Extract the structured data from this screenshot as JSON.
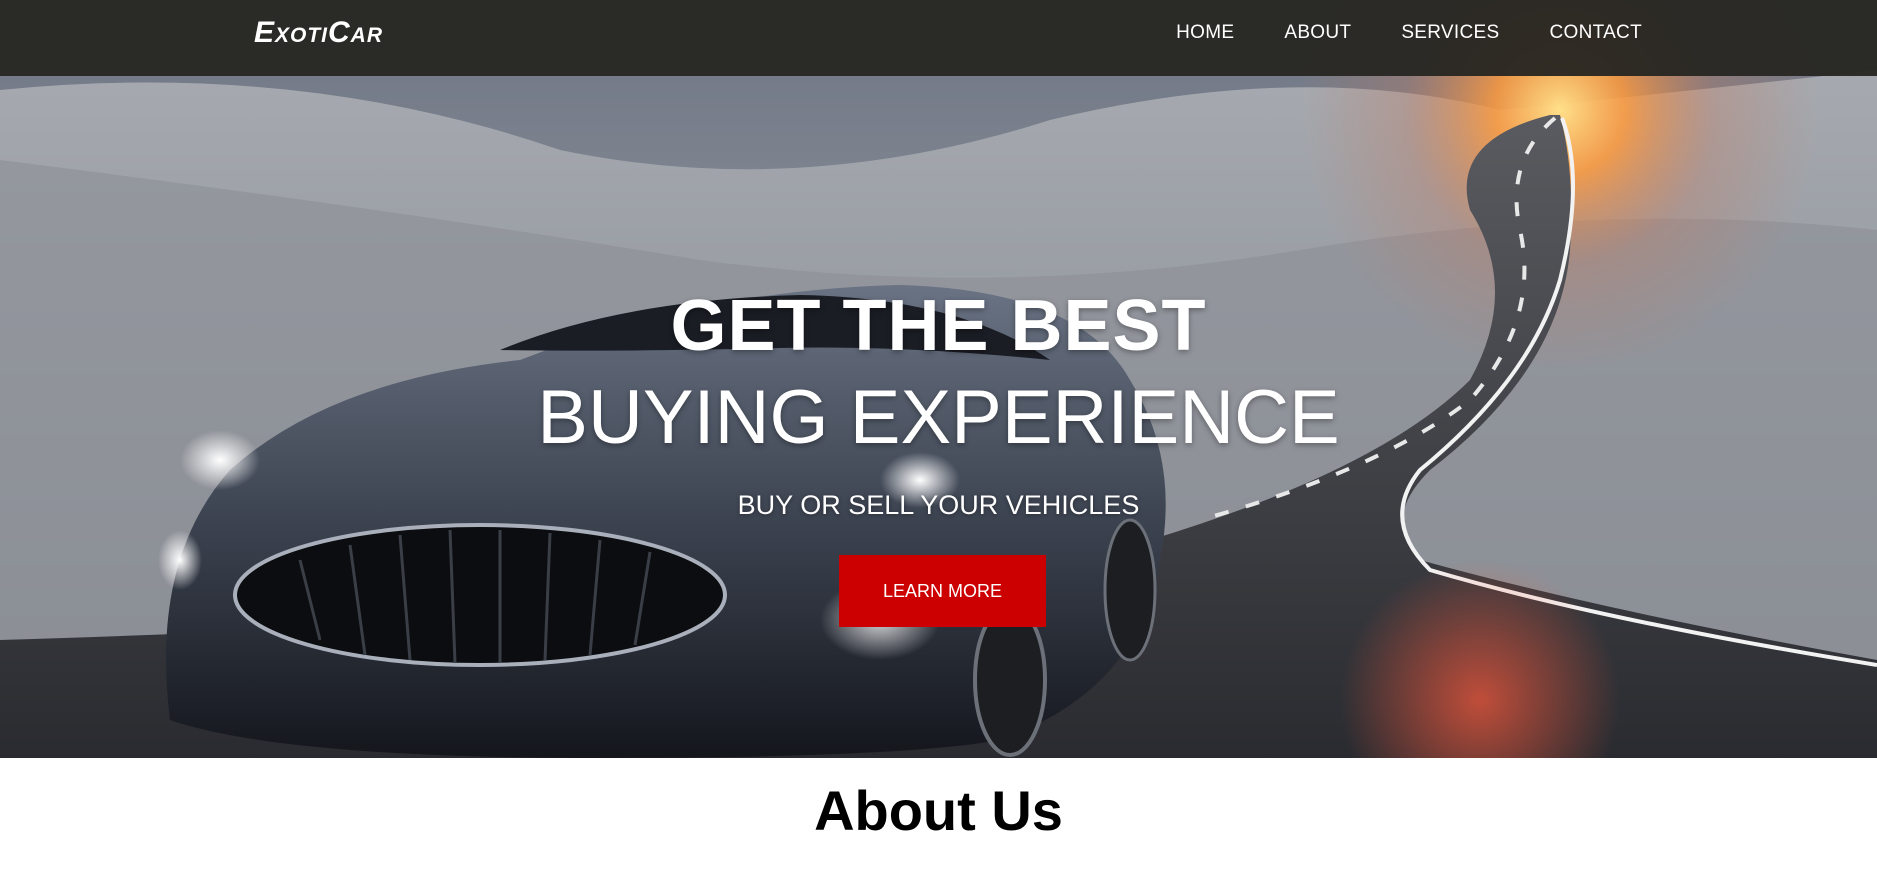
{
  "brand": {
    "logo_text": "ExotiCar"
  },
  "nav": {
    "items": [
      "HOME",
      "ABOUT",
      "SERVICES",
      "CONTACT"
    ]
  },
  "hero": {
    "headline_line1": "GET THE BEST",
    "headline_line2": "BUYING EXPERIENCE",
    "subheadline": "BUY OR SELL YOUR VEHICLES",
    "cta_label": "LEARN MORE",
    "background_image": "sports car on desert road at sunset"
  },
  "about": {
    "title": "About Us"
  },
  "colors": {
    "navbar_bg": "#2b2925",
    "cta_bg": "#cc0000",
    "text_light": "#ffffff",
    "text_dark": "#000000"
  }
}
